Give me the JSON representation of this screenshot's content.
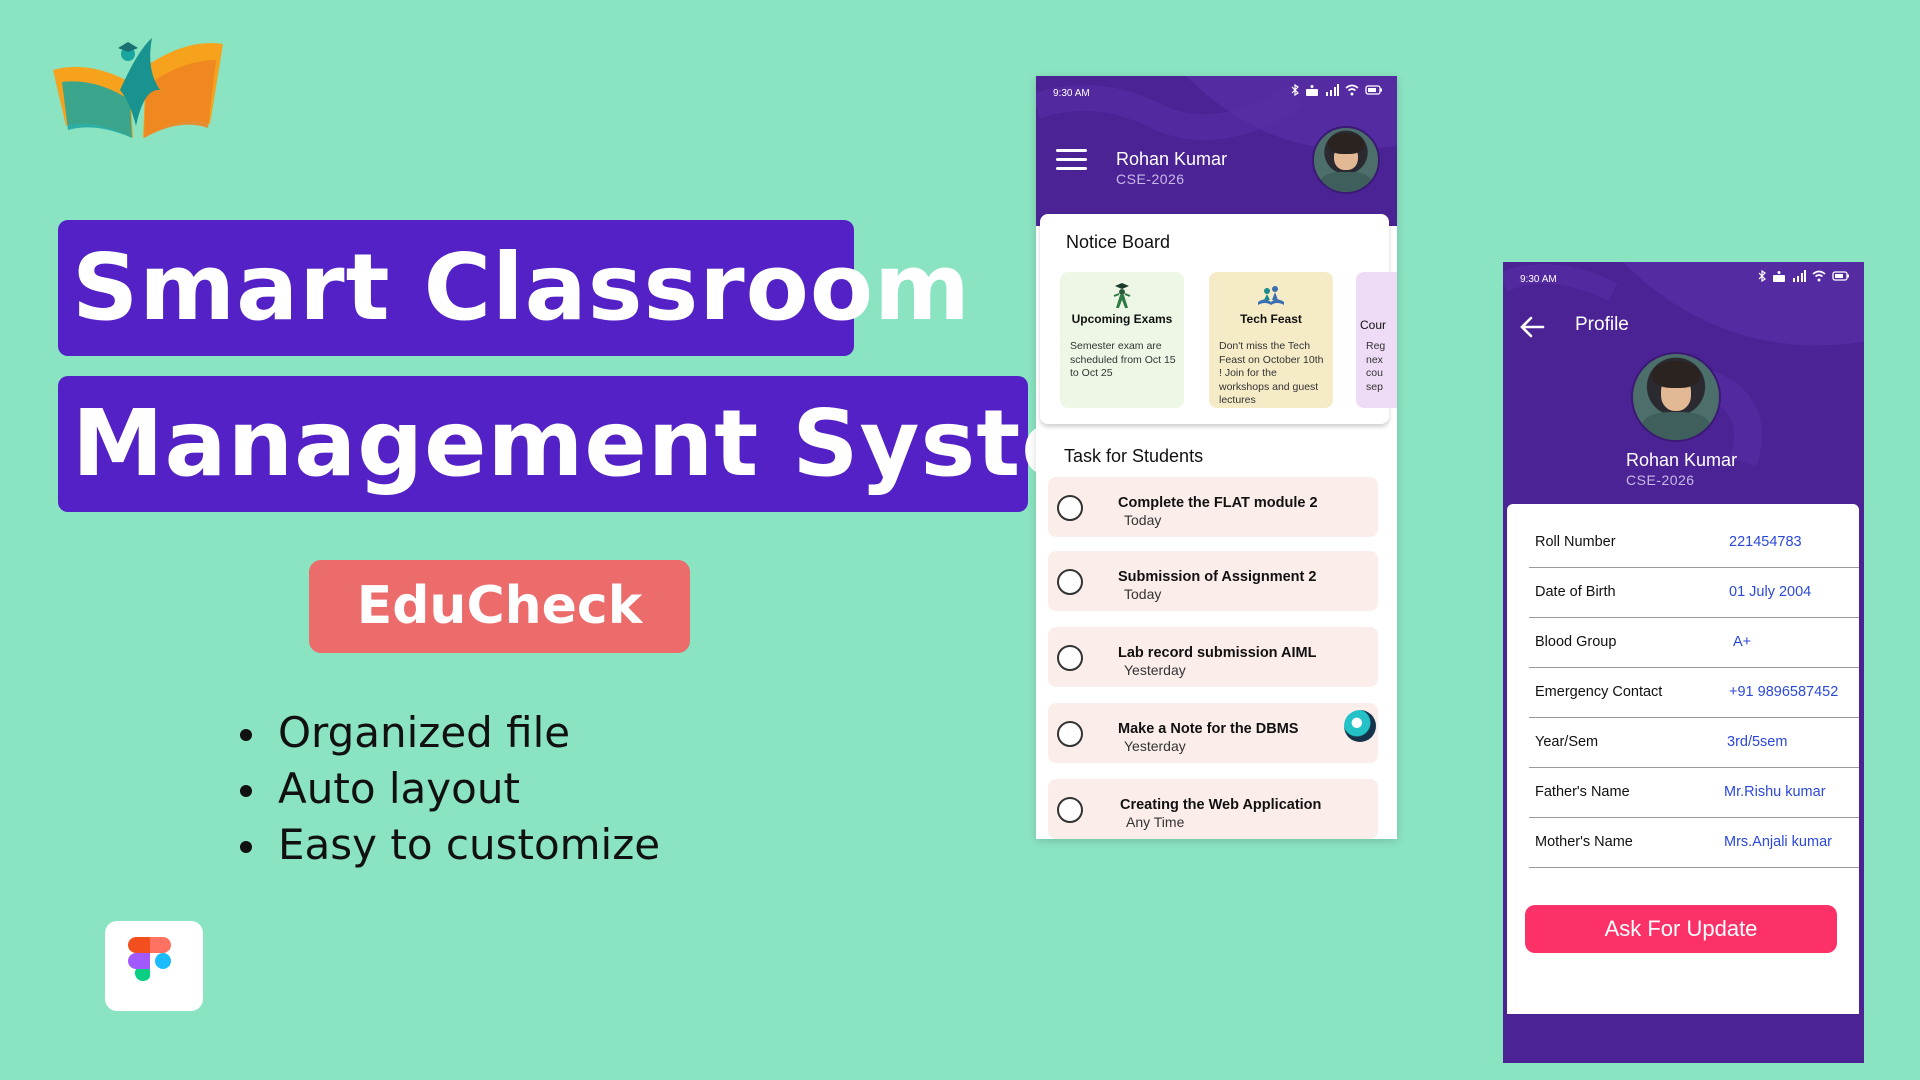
{
  "colors": {
    "background": "#8ae3c1",
    "title_bg": "#5321c6",
    "brand_bg": "#ec6b6b",
    "phone_header": "#4b2395",
    "link_blue": "#2b48d9",
    "button_pink": "#fb3168"
  },
  "hero": {
    "title_line1": "Smart Classroom",
    "title_line2": "Management System",
    "brand": "EduCheck",
    "features": [
      "Organized file",
      "Auto layout",
      "Easy to customize"
    ]
  },
  "phone1": {
    "status_time": "9:30 AM",
    "user": {
      "name": "Rohan Kumar",
      "class": "CSE-2026"
    },
    "notice_board": {
      "title": "Notice Board",
      "items": [
        {
          "icon": "graduate-icon",
          "title": "Upcoming Exams",
          "body": "Semester exam are scheduled from Oct 15 to Oct 25",
          "bg": "#eef7e6"
        },
        {
          "icon": "book-reading-icon",
          "title": "Tech Feast",
          "body": "Don't miss the Tech Feast on October 10th ! Join for the workshops and guest lectures",
          "bg": "#f6ebc7"
        },
        {
          "icon": "course-icon",
          "title": "Cour",
          "body": "Reg nex cou sep",
          "bg": "#eedcf6"
        }
      ]
    },
    "tasks": {
      "title": "Task for Students",
      "items": [
        {
          "title": "Complete the FLAT module 2",
          "when": "Today"
        },
        {
          "title": "Submission of Assignment 2",
          "when": "Today"
        },
        {
          "title": "Lab record submission AIML",
          "when": "Yesterday"
        },
        {
          "title": "Make a Note for the DBMS",
          "when": "Yesterday"
        },
        {
          "title": "Creating the Web Application",
          "when": "Any Time"
        }
      ]
    }
  },
  "phone2": {
    "status_time": "9:30 AM",
    "page_title": "Profile",
    "user": {
      "name": "Rohan Kumar",
      "class": "CSE-2026"
    },
    "fields": [
      {
        "label": "Roll Number",
        "value": "221454783"
      },
      {
        "label": "Date of Birth",
        "value": "01 July 2004"
      },
      {
        "label": "Blood Group",
        "value": "A+"
      },
      {
        "label": "Emergency Contact",
        "value": "+91 9896587452"
      },
      {
        "label": "Year/Sem",
        "value": "3rd/5sem"
      },
      {
        "label": "Father's Name",
        "value": "Mr.Rishu kumar"
      },
      {
        "label": "Mother's Name",
        "value": "Mrs.Anjali kumar"
      }
    ],
    "button_label": "Ask For Update"
  }
}
